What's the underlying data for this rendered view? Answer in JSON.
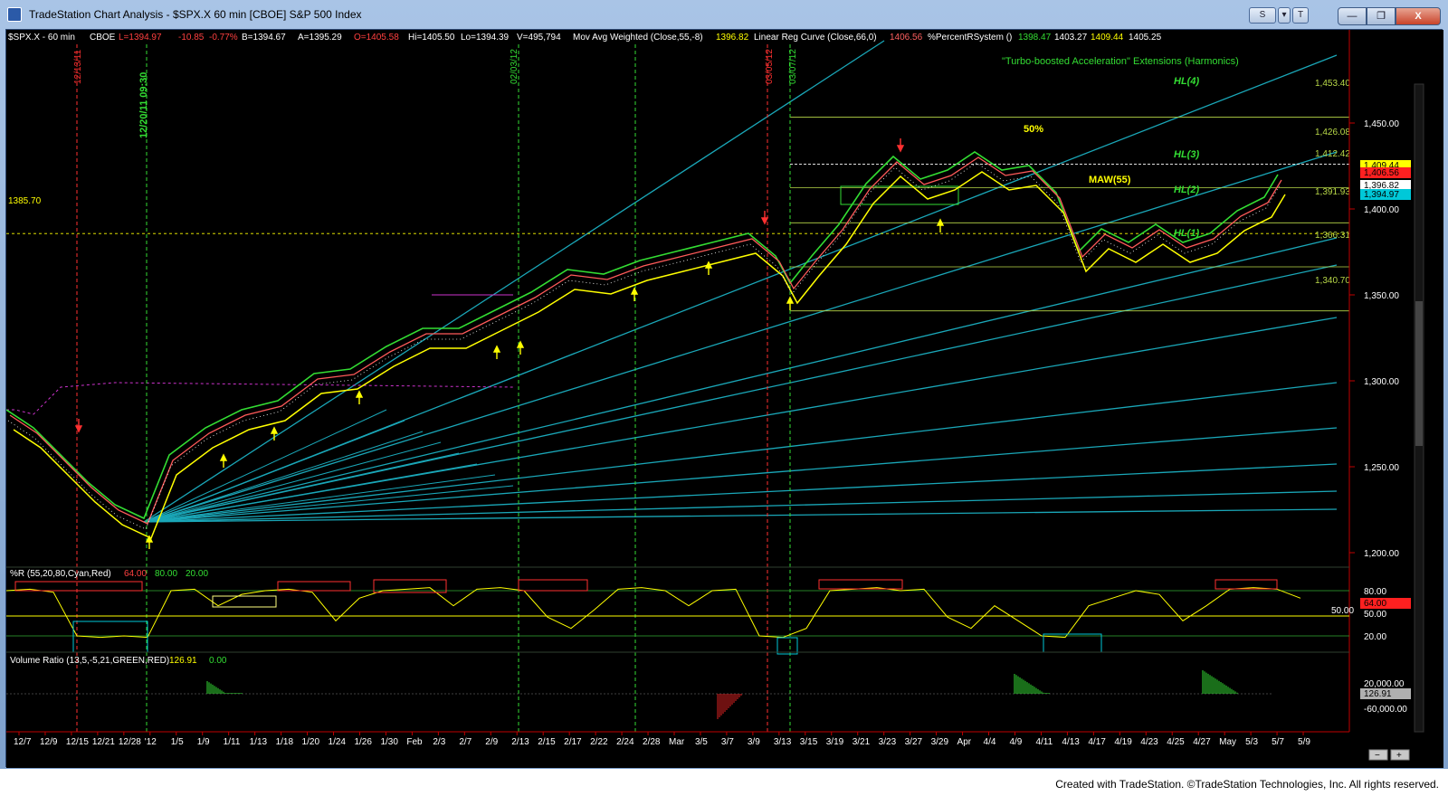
{
  "window": {
    "title": "TradeStation Chart Analysis - $SPX.X 60 min [CBOE] S&P 500 Index",
    "buttons": {
      "s": "S",
      "chart": "▾",
      "pin": "T",
      "minimize": "—",
      "restore": "❐",
      "close": "X"
    }
  },
  "status_line": {
    "symbol": "$SPX.X - 60 min",
    "exchange": "CBOE",
    "last": "L=1394.97",
    "change": "-10.85",
    "pct": "-0.77%",
    "bid": "B=1394.67",
    "ask": "A=1395.29",
    "open": "O=1405.58",
    "high": "Hi=1405.50",
    "low": "Lo=1394.39",
    "volume": "V=495,794",
    "mavw_label": "Mov Avg Weighted (Close,55,-8)",
    "mavw_value": "1396.82",
    "lrc_label": "Linear Reg Curve (Close,66,0)",
    "lrc_value": "1406.56",
    "prs_label": "%PercentRSystem ()",
    "prs_v1": "1398.47",
    "prs_v2": "1403.27",
    "prs_v3": "1409.44",
    "prs_v4": "1405.25"
  },
  "annotations": {
    "extensions_title": "\"Turbo-boosted Acceleration\" Extensions (Harmonics)",
    "fifty": "50%",
    "hl4": "HL(4)",
    "hl3": "HL(3)",
    "hl2": "HL(2)",
    "hl1": "HL(1)",
    "maw": "MAW(55)",
    "date_1213": "12/13/11",
    "date_1220": "12/20/11 09:30",
    "date_0203": "02/03/12",
    "date_0305": "03/05/12",
    "date_0307": "03/07/12",
    "level_left": "1385.70"
  },
  "levels": {
    "l1453": "1,453.40",
    "l1426": "1,426.08",
    "l1412": "1,412.42",
    "l1391": "1,391.93",
    "l1366": "1,366.31",
    "l1340": "1,340.70"
  },
  "price_axis": {
    "ticks": [
      "1,450.00",
      "1,400.00",
      "1,350.00",
      "1,300.00",
      "1,250.00",
      "1,200.00"
    ],
    "tag_yellow": "1,409.44",
    "tag_red": "1,406.56",
    "tag_white": "1,396.82",
    "tag_cyan": "1,394.97"
  },
  "wr_panel": {
    "label": "%R (55,20,80,Cyan,Red)",
    "value": "64.00",
    "v80": "80.00",
    "v20": "20.00",
    "ticks": [
      "80.00",
      "50.00",
      "20.00"
    ],
    "level50": "50.00",
    "tag": "64.00"
  },
  "vol_panel": {
    "label": "Volume Ratio (13,5,-5,21,GREEN,RED)",
    "value": "126.91",
    "zero": "0.00",
    "ticks": [
      "20,000.00",
      "-60,000.00"
    ],
    "tag": "126.91"
  },
  "x_axis": [
    "12/7",
    "12/9",
    "12/15",
    "12/21",
    "12/28",
    "'12",
    "1/5",
    "1/9",
    "1/11",
    "1/13",
    "1/18",
    "1/20",
    "1/24",
    "1/26",
    "1/30",
    "Feb",
    "2/3",
    "2/7",
    "2/9",
    "2/13",
    "2/15",
    "2/17",
    "2/22",
    "2/24",
    "2/28",
    "Mar",
    "3/5",
    "3/7",
    "3/9",
    "3/13",
    "3/15",
    "3/19",
    "3/21",
    "3/23",
    "3/27",
    "3/29",
    "Apr",
    "4/4",
    "4/9",
    "4/11",
    "4/13",
    "4/17",
    "4/19",
    "4/23",
    "4/25",
    "4/27",
    "May",
    "5/3",
    "5/7",
    "5/9"
  ],
  "footer": "Created with TradeStation. ©TradeStation Technologies, Inc. All rights reserved.",
  "colors": {
    "yellow": "#ffff00",
    "red": "#ff3030",
    "cyan": "#00c8d8",
    "green": "#33dd33",
    "magenta": "#cc33cc",
    "gann": "#1aa7b8"
  }
}
